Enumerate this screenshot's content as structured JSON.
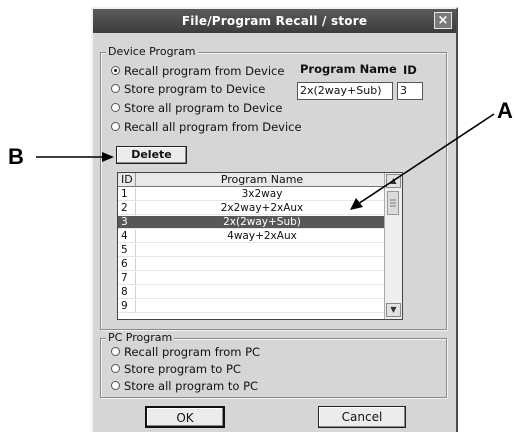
{
  "window": {
    "title": "File/Program Recall / store",
    "close_glyph": "×"
  },
  "device_program": {
    "legend": "Device Program",
    "options": [
      {
        "label": "Recall program from Device",
        "selected": true
      },
      {
        "label": "Store program to Device",
        "selected": false
      },
      {
        "label": "Store all program to Device",
        "selected": false
      },
      {
        "label": "Recall all program from Device",
        "selected": false
      }
    ],
    "program_name_header": "Program Name",
    "id_header": "ID",
    "program_name_value": "2x(2way+Sub)",
    "id_value": "3",
    "delete_label": "Delete"
  },
  "program_list": {
    "columns": [
      "ID",
      "Program Name"
    ],
    "rows": [
      {
        "id": "1",
        "name": "3x2way",
        "selected": false
      },
      {
        "id": "2",
        "name": "2x2way+2xAux",
        "selected": false
      },
      {
        "id": "3",
        "name": "2x(2way+Sub)",
        "selected": true
      },
      {
        "id": "4",
        "name": "4way+2xAux",
        "selected": false
      },
      {
        "id": "5",
        "name": "",
        "selected": false
      },
      {
        "id": "6",
        "name": "",
        "selected": false
      },
      {
        "id": "7",
        "name": "",
        "selected": false
      },
      {
        "id": "8",
        "name": "",
        "selected": false
      },
      {
        "id": "9",
        "name": "",
        "selected": false
      }
    ],
    "scroll_up_glyph": "▲",
    "scroll_down_glyph": "▼"
  },
  "pc_program": {
    "legend": "PC Program",
    "options": [
      {
        "label": "Recall program from PC",
        "selected": false
      },
      {
        "label": "Store program to PC",
        "selected": false
      },
      {
        "label": "Store all program to PC",
        "selected": false
      }
    ]
  },
  "buttons": {
    "ok": "OK",
    "cancel": "Cancel"
  },
  "callouts": {
    "a": "A",
    "b": "B"
  }
}
